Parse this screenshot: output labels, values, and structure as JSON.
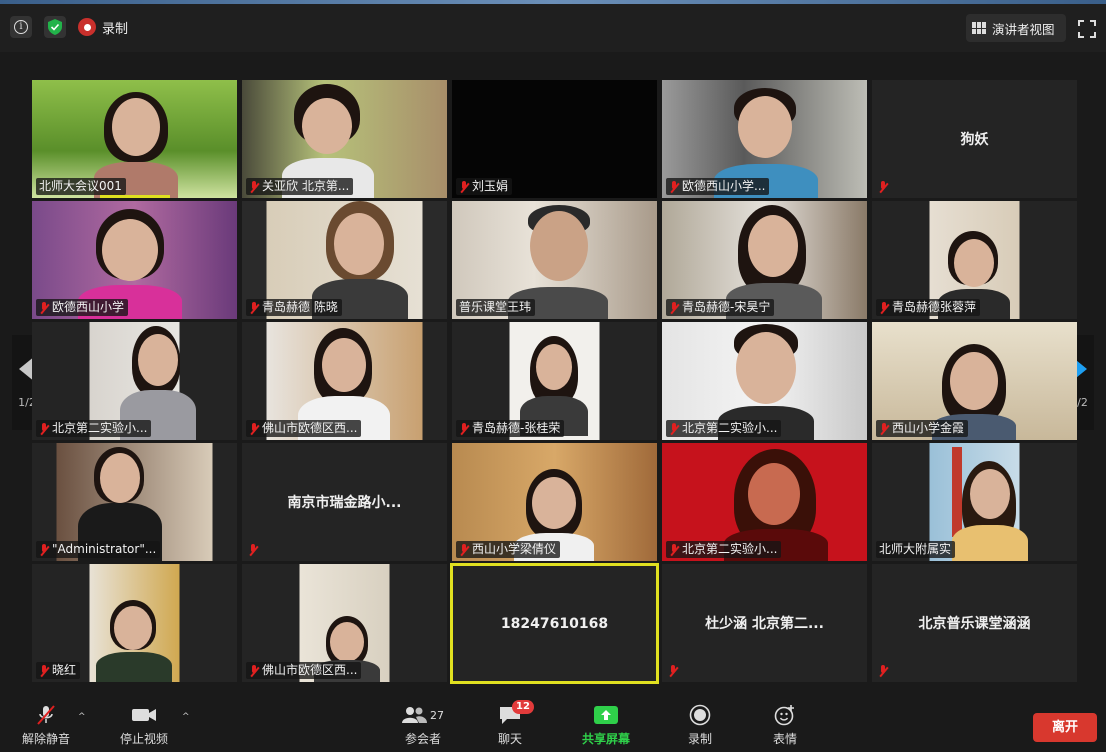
{
  "topbar": {
    "recording_label": "录制",
    "view_button_label": "演讲者视图",
    "icons": [
      "info-icon",
      "shield-icon",
      "record-icon",
      "grid-view-icon",
      "fullscreen-icon"
    ]
  },
  "navigation": {
    "page_indicator": "1/2"
  },
  "tiles": [
    {
      "id": "t1",
      "label": "北师大会议001",
      "mic_muted": false,
      "name_only": false
    },
    {
      "id": "t2",
      "label": "关亚欣 北京第...",
      "mic_muted": true,
      "name_only": false
    },
    {
      "id": "t3",
      "label": "刘玉娟",
      "mic_muted": true,
      "name_only": false
    },
    {
      "id": "t4",
      "label": "欧德西山小学...",
      "mic_muted": true,
      "name_only": false
    },
    {
      "id": "t5",
      "label": "",
      "center_name": "狗妖",
      "mic_muted": true,
      "name_only": true
    },
    {
      "id": "t6",
      "label": "欧德西山小学",
      "mic_muted": true,
      "name_only": false
    },
    {
      "id": "t7",
      "label": "青岛赫德 陈晓",
      "mic_muted": true,
      "name_only": false
    },
    {
      "id": "t8",
      "label": "普乐课堂王玮",
      "mic_muted": false,
      "name_only": false
    },
    {
      "id": "t9",
      "label": "青岛赫德-宋昊宁",
      "mic_muted": true,
      "name_only": false
    },
    {
      "id": "t10",
      "label": "青岛赫德张蓉萍",
      "mic_muted": true,
      "name_only": false
    },
    {
      "id": "t11",
      "label": "北京第二实验小...",
      "mic_muted": true,
      "name_only": false
    },
    {
      "id": "t12",
      "label": "佛山市欧德区西...",
      "mic_muted": true,
      "name_only": false
    },
    {
      "id": "t13",
      "label": "青岛赫德-张桂荣",
      "mic_muted": true,
      "name_only": false
    },
    {
      "id": "t14",
      "label": "北京第二实验小...",
      "mic_muted": true,
      "name_only": false
    },
    {
      "id": "t15",
      "label": "西山小学金霞",
      "mic_muted": true,
      "name_only": false
    },
    {
      "id": "t16",
      "label": "\"Administrator\"...",
      "mic_muted": true,
      "name_only": false
    },
    {
      "id": "t17",
      "label": "",
      "center_name": "南京市瑞金路小...",
      "mic_muted": true,
      "name_only": true
    },
    {
      "id": "t18",
      "label": "西山小学梁倩仪",
      "mic_muted": true,
      "name_only": false
    },
    {
      "id": "t19",
      "label": "北京第二实验小...",
      "mic_muted": true,
      "name_only": false
    },
    {
      "id": "t20",
      "label": "北师大附属实",
      "mic_muted": false,
      "name_only": false
    },
    {
      "id": "t21",
      "label": "晓红",
      "mic_muted": true,
      "name_only": false
    },
    {
      "id": "t22",
      "label": "佛山市欧德区西...",
      "mic_muted": true,
      "name_only": false
    },
    {
      "id": "t23",
      "label": "",
      "center_name": "18247610168",
      "mic_muted": false,
      "name_only": true,
      "speaking": true
    },
    {
      "id": "t24",
      "label": "",
      "center_name": "杜少涵 北京第二...",
      "mic_muted": true,
      "name_only": true
    },
    {
      "id": "t25",
      "label": "",
      "center_name": "北京普乐课堂涵涵",
      "mic_muted": true,
      "name_only": true
    }
  ],
  "toolbar": {
    "mute_label": "解除静音",
    "video_label": "停止视频",
    "participants_label": "参会者",
    "participants_count": "27",
    "chat_label": "聊天",
    "chat_badge": "12",
    "share_label": "共享屏幕",
    "record_label": "录制",
    "reactions_label": "表情",
    "leave_label": "离开"
  },
  "colors": {
    "speaking_border": "#e0e020",
    "share_green": "#2fd04a",
    "leave_red": "#d8382e",
    "muted_red": "#e02020",
    "arrow_blue": "#1e9ff2"
  }
}
